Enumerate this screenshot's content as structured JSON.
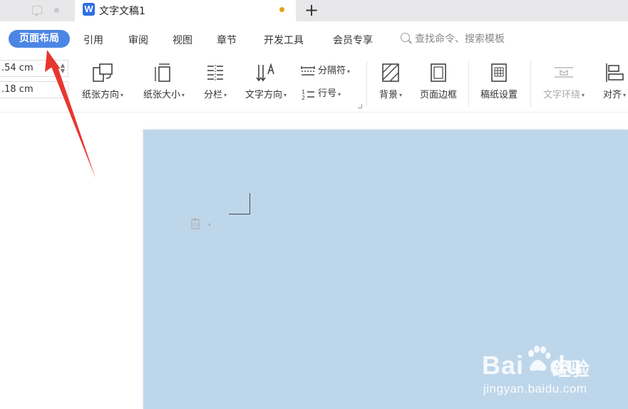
{
  "tabs": {
    "active_title": "文字文稿1",
    "doc_icon_letter": "W",
    "new_tab_label": "+"
  },
  "menu": {
    "active": "页面布局",
    "items": [
      "引用",
      "审阅",
      "视图",
      "章节",
      "开发工具",
      "会员专享"
    ],
    "search_placeholder": "查找命令、搜索模板"
  },
  "ribbon": {
    "margins": [
      ".54 cm",
      ".18 cm"
    ],
    "tools": {
      "orientation": "纸张方向",
      "size": "纸张大小",
      "columns": "分栏",
      "text_direction": "文字方向",
      "separator": "分隔符",
      "line_number": "行号",
      "background": "背景",
      "page_border": "页面边框",
      "manuscript": "稿纸设置",
      "text_wrap": "文字环绕",
      "align": "对齐"
    }
  },
  "watermark": {
    "brand": "Bai",
    "brand_suffix": "du",
    "jingyan": "经验",
    "url": "jingyan.baidu.com"
  },
  "colors": {
    "accent": "#4b86e5",
    "page_background": "#bed6ea",
    "annotation_arrow": "#e8352f",
    "unsaved_dot": "#e1a11a"
  }
}
